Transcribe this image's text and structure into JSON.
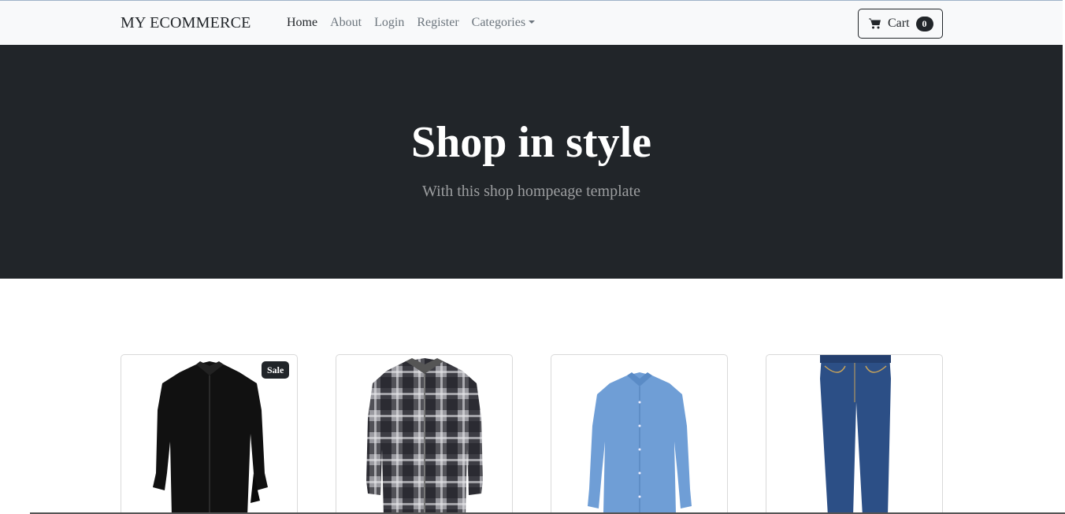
{
  "navbar": {
    "brand": "MY ECOMMERCE",
    "links": [
      {
        "label": "Home",
        "active": true
      },
      {
        "label": "About"
      },
      {
        "label": "Login"
      },
      {
        "label": "Register"
      },
      {
        "label": "Categories"
      }
    ],
    "cart": {
      "label": "Cart",
      "count": "0",
      "icon": "cart-icon"
    }
  },
  "hero": {
    "title": "Shop in style",
    "subtitle": "With this shop hompeage template"
  },
  "products": [
    {
      "image": "black-shirt",
      "badge": "Sale"
    },
    {
      "image": "plaid-shirt"
    },
    {
      "image": "blue-shirt"
    },
    {
      "image": "jeans"
    }
  ],
  "colors": {
    "hero_bg": "#212529",
    "navbar_bg": "#f8f9fa",
    "accent": "#212529"
  }
}
